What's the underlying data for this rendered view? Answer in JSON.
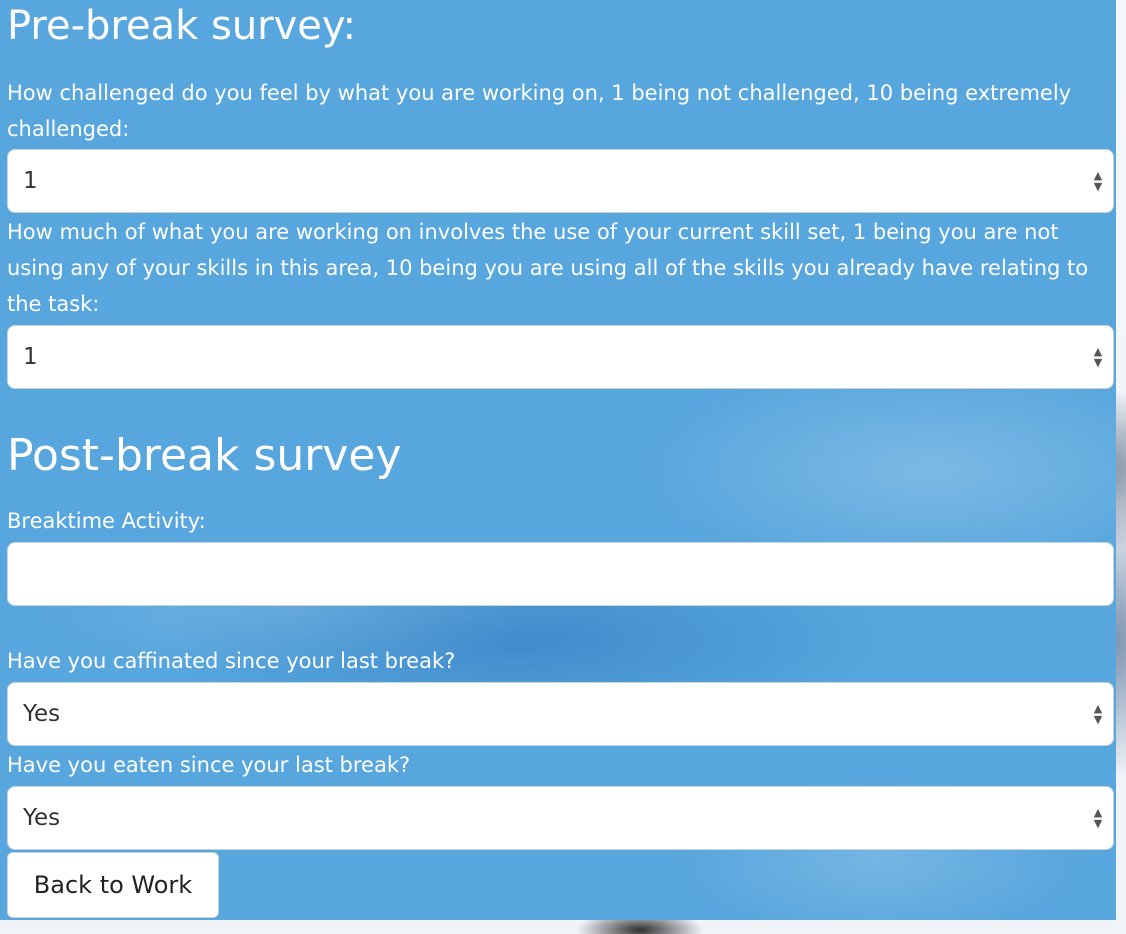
{
  "pre_break": {
    "title": "Pre-break survey:",
    "q1": {
      "label": "How challenged do you feel by what you are working on, 1 being not challenged, 10 being extremely challenged:",
      "value": "1"
    },
    "q2": {
      "label": "How much of what you are working on involves the use of your current skill set, 1 being you are not using any of your skills in this area, 10 being you are using all of the skills you already have relating to the task:",
      "value": "1"
    }
  },
  "post_break": {
    "title": "Post-break survey",
    "activity": {
      "label": "Breaktime Activity:",
      "value": ""
    },
    "caffeine": {
      "label": "Have you caffinated since your last break?",
      "value": "Yes"
    },
    "eaten": {
      "label": "Have you eaten since your last break?",
      "value": "Yes"
    }
  },
  "actions": {
    "back_label": "Back to Work"
  },
  "icons": {
    "select_arrows": "up-down-caret-icon"
  },
  "colors": {
    "panel_background": "#57a6dd",
    "label_text": "#ffffff",
    "field_background": "#ffffff"
  }
}
